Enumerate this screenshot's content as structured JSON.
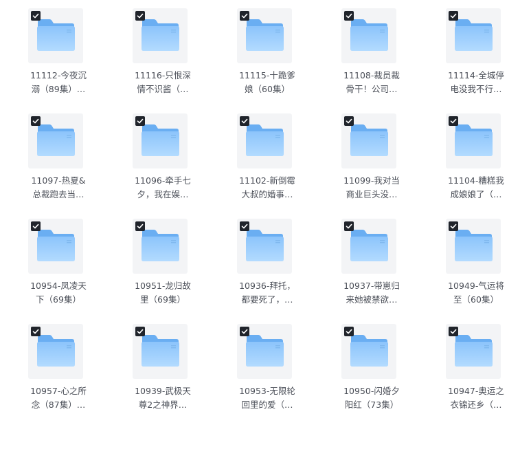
{
  "folders": [
    {
      "name": "11112-今夜沉\n溺（89集）…",
      "selected": true
    },
    {
      "name": "11116-只恨深\n情不识酱（…",
      "selected": true
    },
    {
      "name": "11115-十跪爹\n娘（60集）",
      "selected": true
    },
    {
      "name": "11108-裁员裁\n骨干！公司…",
      "selected": true
    },
    {
      "name": "11114-全城停\n电没我不行…",
      "selected": true
    },
    {
      "name": "11097-热夏&\n总裁跑去当…",
      "selected": true
    },
    {
      "name": "11096-牵手七\n夕，我在娱…",
      "selected": true
    },
    {
      "name": "11102-新倒霉\n大叔的婚事…",
      "selected": true
    },
    {
      "name": "11099-我对当\n商业巨头没…",
      "selected": true
    },
    {
      "name": "11104-糟糕我\n成娘娘了（…",
      "selected": true
    },
    {
      "name": "10954-凤凌天\n下（69集）",
      "selected": true
    },
    {
      "name": "10951-龙归故\n里（69集）",
      "selected": true
    },
    {
      "name": "10936-拜托，\n都要死了，…",
      "selected": true
    },
    {
      "name": "10937-带崽归\n来她被禁欲…",
      "selected": true
    },
    {
      "name": "10949-气运将\n至（60集）",
      "selected": true
    },
    {
      "name": "10957-心之所\n念（87集）…",
      "selected": true
    },
    {
      "name": "10939-武极天\n尊2之神界…",
      "selected": true
    },
    {
      "name": "10953-无限轮\n回里的爱（…",
      "selected": true
    },
    {
      "name": "10950-闪婚夕\n阳红（73集）",
      "selected": true
    },
    {
      "name": "10947-奥运之\n衣锦还乡（…",
      "selected": true
    }
  ],
  "colors": {
    "folder_back": "#6aaef2",
    "folder_front": "#a9d3ff",
    "checkbox": "#20242b"
  },
  "icons": {
    "folder": "folder-icon",
    "check": "checkbox-checked-icon"
  }
}
